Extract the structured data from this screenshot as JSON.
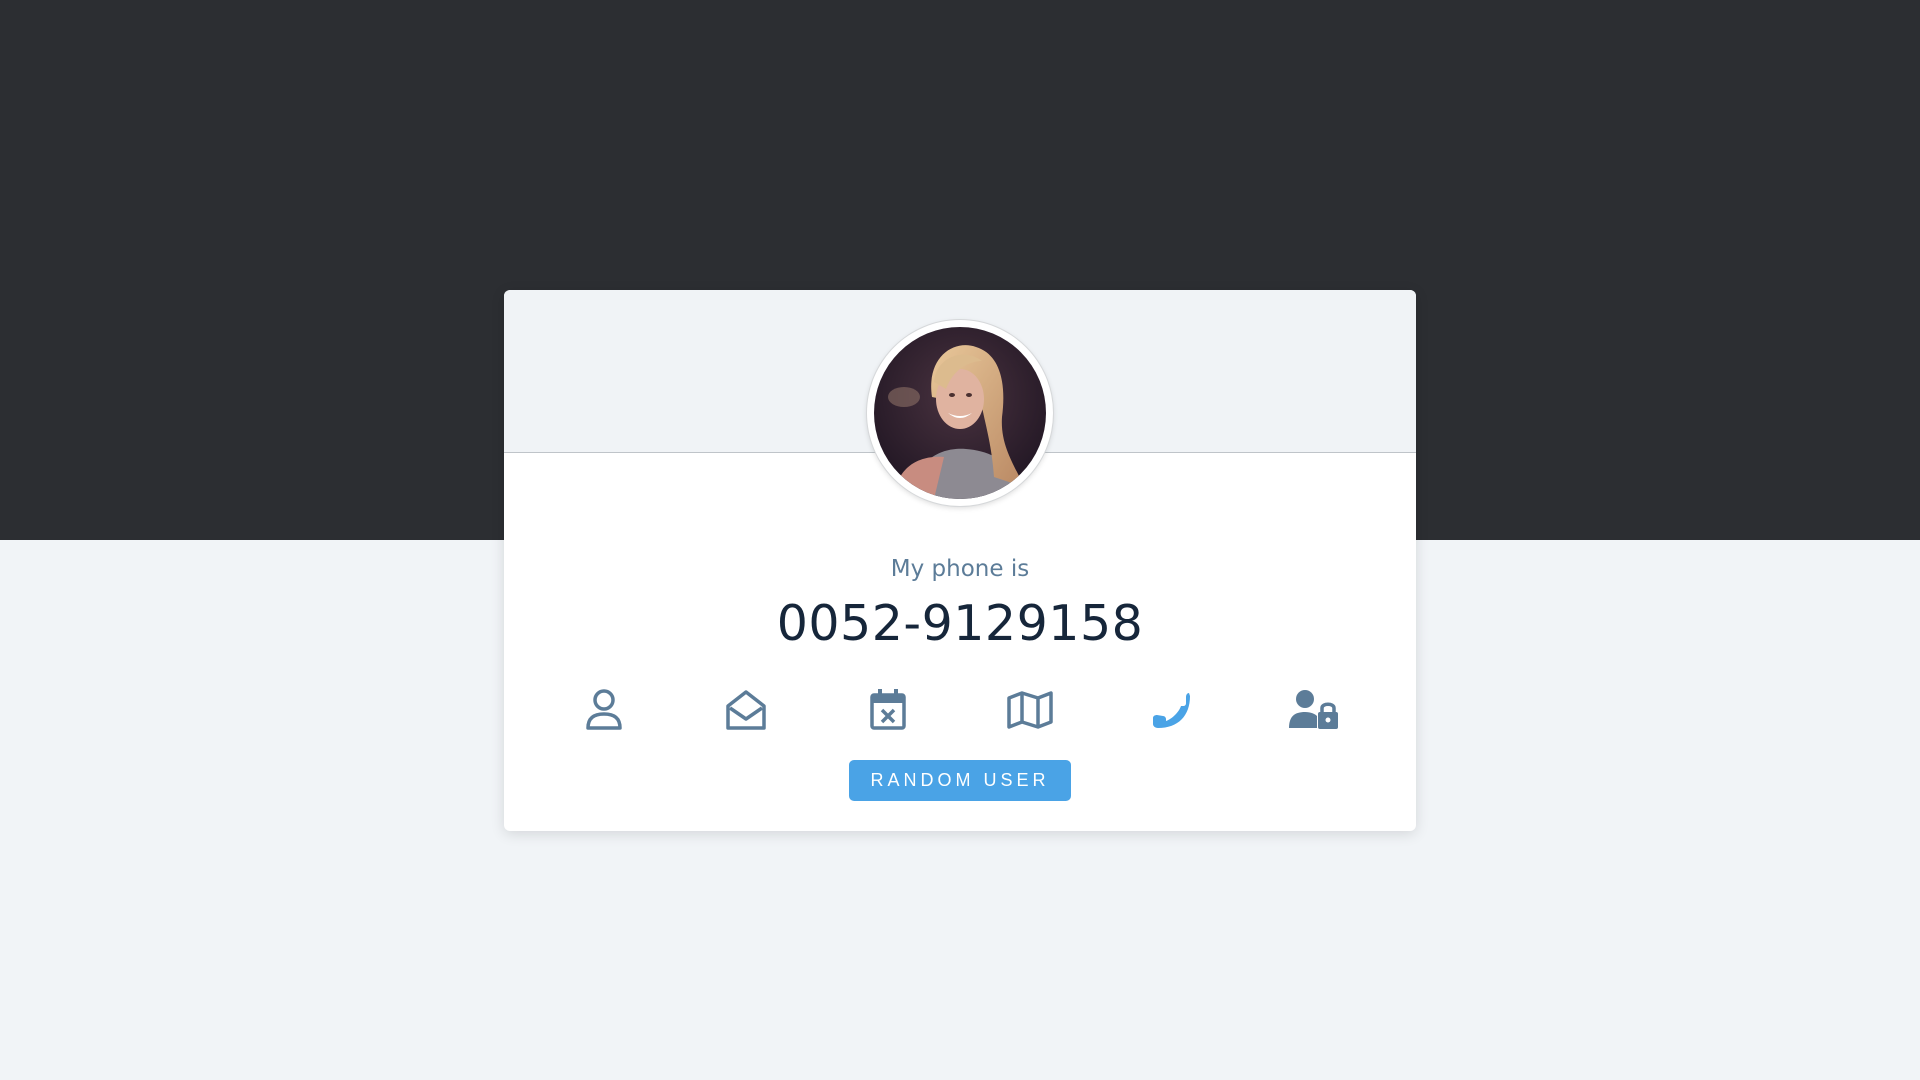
{
  "profile": {
    "label": "My phone is",
    "value": "0052-9129158"
  },
  "tabs": [
    {
      "icon": "user-icon",
      "key": "name"
    },
    {
      "icon": "envelope-open-icon",
      "key": "email"
    },
    {
      "icon": "calendar-x-icon",
      "key": "birthday"
    },
    {
      "icon": "map-icon",
      "key": "location"
    },
    {
      "icon": "phone-icon",
      "key": "phone",
      "active": true
    },
    {
      "icon": "user-lock-icon",
      "key": "password"
    }
  ],
  "button": {
    "label": "RANDOM USER"
  },
  "colors": {
    "top_band": "#2c2e32",
    "background": "#f1f4f7",
    "accent": "#4aa3e6",
    "icon": "#5c7c98",
    "value_text": "#16263a"
  }
}
